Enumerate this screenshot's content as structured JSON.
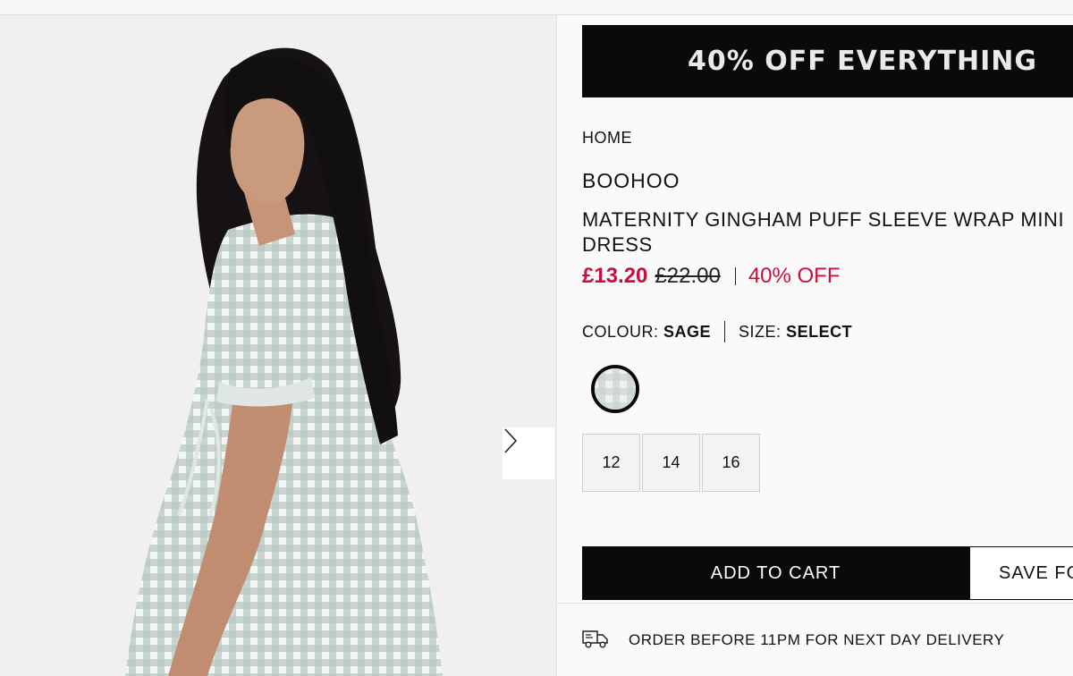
{
  "promo": {
    "text": "40% OFF EVERYTHING"
  },
  "breadcrumb": "HOME",
  "product": {
    "brand": "BOOHOO",
    "title": "MATERNITY GINGHAM PUFF SLEEVE WRAP MINI DRESS",
    "price_now": "£13.20",
    "price_was": "£22.00",
    "discount": "40% OFF"
  },
  "options": {
    "colour_label": "COLOUR:",
    "colour_value": "SAGE",
    "size_label": "SIZE:",
    "size_value": "SELECT",
    "sizes": [
      "12",
      "14",
      "16"
    ]
  },
  "actions": {
    "add_to_cart": "ADD TO CART",
    "save": "SAVE FO"
  },
  "delivery": {
    "text": "ORDER BEFORE 11PM FOR NEXT DAY DELIVERY"
  },
  "icons": {
    "next": "chevron-right-icon",
    "delivery": "truck-icon",
    "swatch": "gingham-swatch"
  },
  "colors": {
    "sale": "#c8103e",
    "black": "#0a0a0a"
  }
}
